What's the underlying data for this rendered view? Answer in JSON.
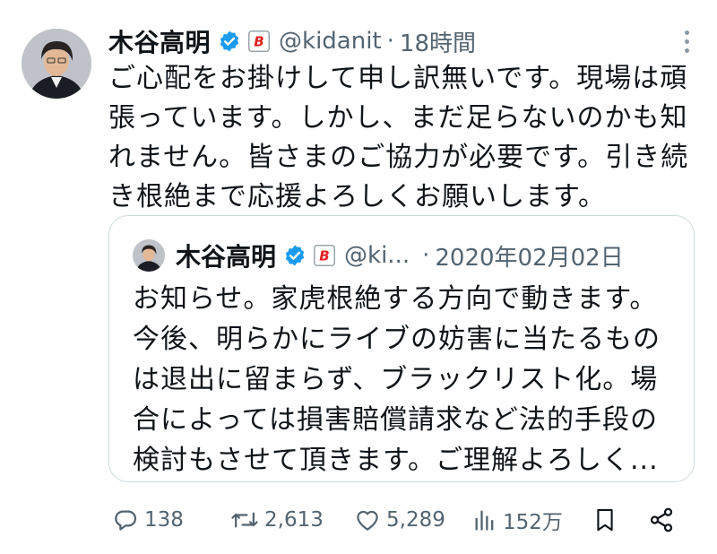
{
  "tweet": {
    "author_name": "木谷高明",
    "handle": "@kidanit",
    "separator": "·",
    "time": "18時間",
    "text": "ご心配をお掛けして申し訳無いです。現場は頑張っています。しかし、まだ足らないのかも知れません。皆さまのご協力が必要です。引き続き根絶まで応援よろしくお願いします。"
  },
  "quoted_tweet": {
    "author_name": "木谷高明",
    "handle": "@ki...",
    "separator": "·",
    "date": "2020年02月02日",
    "text": "お知らせ。家虎根絶する方向で動きます。今後、明らかにライブの妨害に当たるものは退出に留まらず、ブラックリスト化。場合によっては損害賠償請求など法的手段の検討もさせて頂きます。ご理解よろしく..."
  },
  "actions": {
    "replies": "138",
    "retweets": "2,613",
    "likes": "5,289",
    "views": "152万"
  },
  "colors": {
    "verified_blue": "#1d9bf0",
    "secondary_text": "#536471",
    "badge_red": "#e0201e"
  },
  "icons": [
    "verified-icon",
    "bushiroad-b-icon",
    "more-options-icon",
    "reply-icon",
    "retweet-icon",
    "like-icon",
    "views-icon",
    "bookmark-icon",
    "share-icon"
  ]
}
